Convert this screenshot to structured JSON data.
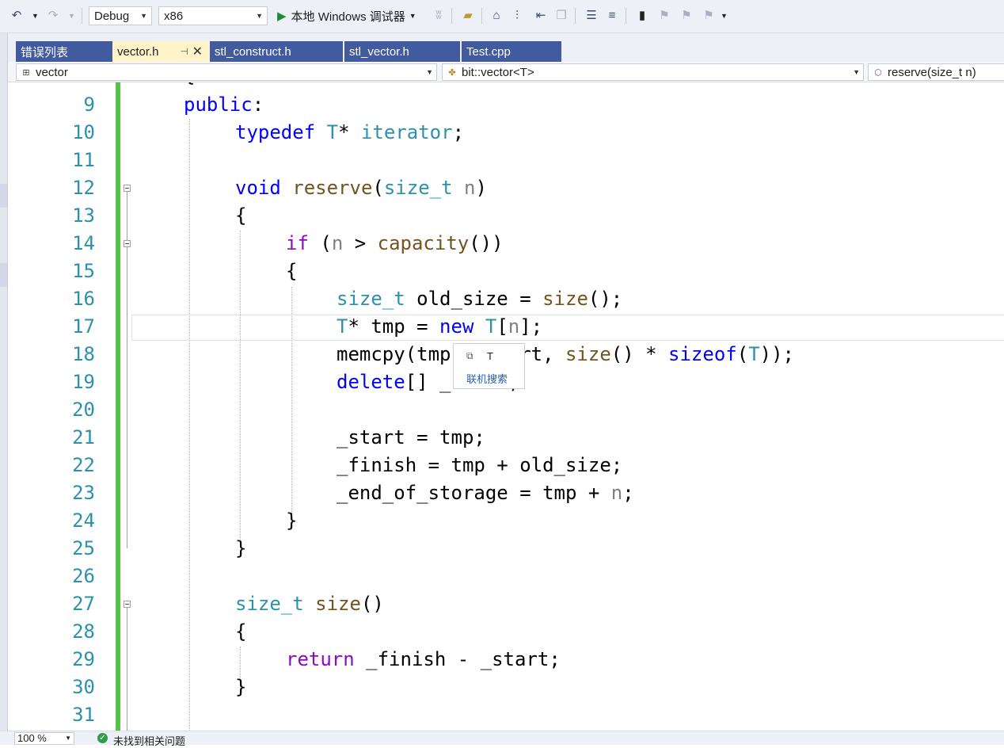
{
  "toolbar": {
    "config": "Debug",
    "platform": "x86",
    "run_label": "本地 Windows 调试器"
  },
  "tabs": [
    {
      "label": "错误列表",
      "active": false
    },
    {
      "label": "vector.h",
      "active": true
    },
    {
      "label": "stl_construct.h",
      "active": false
    },
    {
      "label": "stl_vector.h",
      "active": false
    },
    {
      "label": "Test.cpp",
      "active": false
    }
  ],
  "navbar": {
    "project": "vector",
    "scope": "bit::vector<T>",
    "member": "reserve(size_t n)"
  },
  "editor": {
    "lines": [
      {
        "n": "9",
        "code": "public:"
      },
      {
        "n": "10",
        "code": "typedef T* iterator;"
      },
      {
        "n": "11",
        "code": ""
      },
      {
        "n": "12",
        "code": "void reserve(size_t n)"
      },
      {
        "n": "13",
        "code": "{"
      },
      {
        "n": "14",
        "code": "if (n > capacity())"
      },
      {
        "n": "15",
        "code": "{"
      },
      {
        "n": "16",
        "code": "size_t old_size = size();"
      },
      {
        "n": "17",
        "code": "T* tmp = new T[n];"
      },
      {
        "n": "18",
        "code": "memcpy(tmp, _start, size() * sizeof(T));"
      },
      {
        "n": "19",
        "code": "delete[] _start;"
      },
      {
        "n": "20",
        "code": ""
      },
      {
        "n": "21",
        "code": "_start = tmp;"
      },
      {
        "n": "22",
        "code": "_finish = tmp + old_size;"
      },
      {
        "n": "23",
        "code": "_end_of_storage = tmp + n;"
      },
      {
        "n": "24",
        "code": "}"
      },
      {
        "n": "25",
        "code": "}"
      },
      {
        "n": "26",
        "code": ""
      },
      {
        "n": "27",
        "code": "size_t size()"
      },
      {
        "n": "28",
        "code": "{"
      },
      {
        "n": "29",
        "code": "return _finish - _start;"
      },
      {
        "n": "30",
        "code": "}"
      },
      {
        "n": "31",
        "code": ""
      }
    ]
  },
  "tooltip": {
    "type_name": "T",
    "online_search": "联机搜索"
  },
  "statusbar": {
    "zoom": "100 %",
    "message": "未找到相关问题"
  },
  "colors": {
    "keyword": "#0000ff",
    "control": "#8f08c4",
    "type": "#2b91af",
    "function": "#74531f",
    "parameter": "#808080",
    "line_number": "#2b91af",
    "change_bar": "#57c24a",
    "tab_active": "#fff4c9",
    "tab_inactive": "#425b9e"
  }
}
